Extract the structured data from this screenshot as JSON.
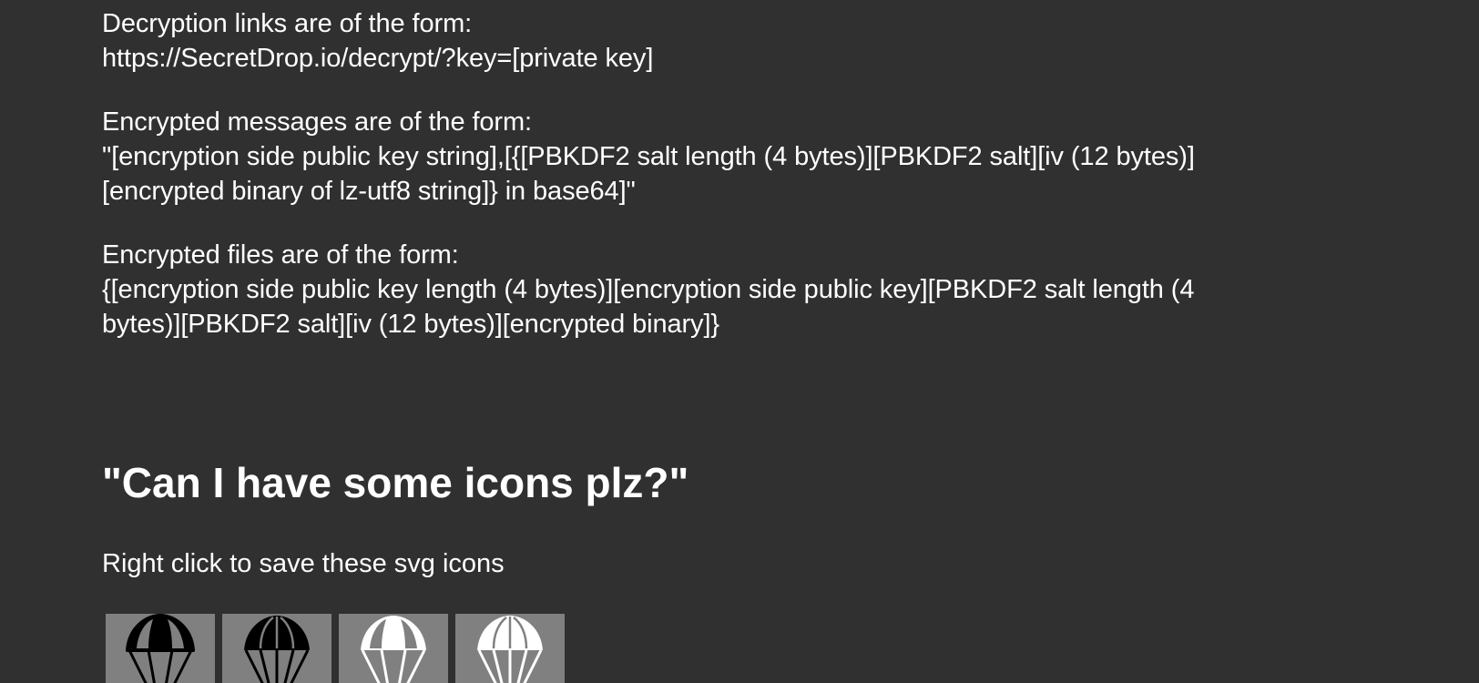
{
  "format_info": {
    "decryption_links": {
      "label": "Decryption links are of the form:",
      "value": "https://SecretDrop.io/decrypt/?key=[private key]"
    },
    "encrypted_messages": {
      "label": "Encrypted messages are of the form:",
      "value_line1": "\"[encryption side public key string],[{[PBKDF2 salt length (4 bytes)][PBKDF2 salt][iv (12 bytes)]",
      "value_line2": "[encrypted binary of lz-utf8 string]} in base64]\""
    },
    "encrypted_files": {
      "label": "Encrypted files are of the form:",
      "value_line1": "{[encryption side public key length (4 bytes)][encryption side public key][PBKDF2 salt length (4",
      "value_line2": "bytes)][PBKDF2 salt][iv (12 bytes)][encrypted binary]}"
    }
  },
  "icons_section": {
    "heading": "\"Can I have some icons plz?\"",
    "hint": "Right click to save these svg icons",
    "icons": [
      {
        "name": "parachute-icon-black-outline",
        "fill": "#000000",
        "variant": "outline"
      },
      {
        "name": "parachute-icon-black-solid",
        "fill": "#000000",
        "variant": "solid"
      },
      {
        "name": "parachute-icon-white-outline",
        "fill": "#ffffff",
        "variant": "outline"
      },
      {
        "name": "parachute-icon-white-solid",
        "fill": "#ffffff",
        "variant": "solid"
      }
    ]
  },
  "colors": {
    "background": "#303030",
    "text": "#ffffff",
    "icon_tile": "#808080"
  }
}
